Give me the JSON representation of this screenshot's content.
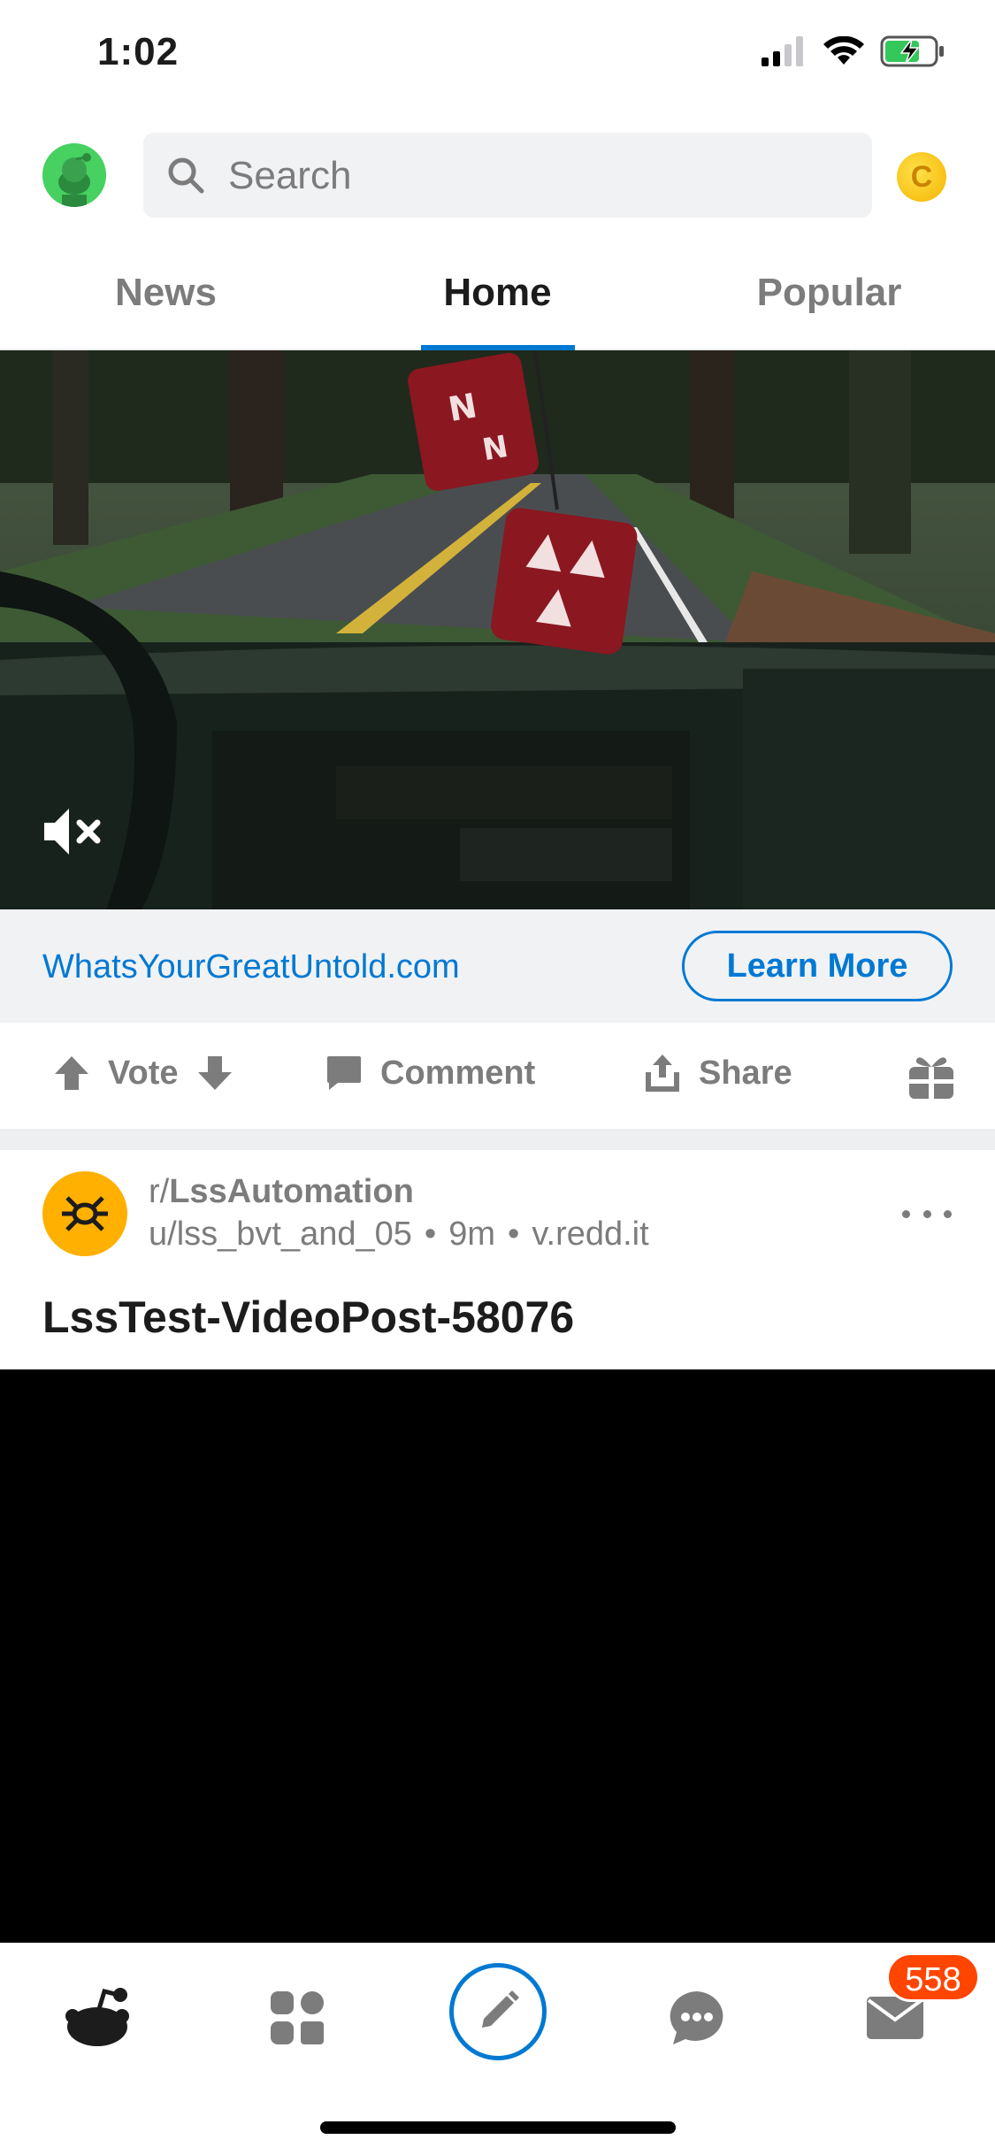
{
  "status_bar": {
    "time": "1:02"
  },
  "search": {
    "placeholder": "Search"
  },
  "coin": {
    "symbol": "C"
  },
  "tabs": [
    {
      "label": "News",
      "active": false
    },
    {
      "label": "Home",
      "active": true
    },
    {
      "label": "Popular",
      "active": false
    }
  ],
  "ad": {
    "domain": "WhatsYourGreatUntold.com",
    "cta_label": "Learn More",
    "actions": {
      "vote_label": "Vote",
      "comment_label": "Comment",
      "share_label": "Share"
    }
  },
  "post": {
    "subreddit_prefix": "r/",
    "subreddit": "LssAutomation",
    "author": "u/lss_bvt_and_05",
    "age": "9m",
    "domain": "v.redd.it",
    "title": "LssTest-VideoPost-58076"
  },
  "bottom_nav": {
    "inbox_badge": "558"
  },
  "colors": {
    "accent": "#0079d3",
    "badge": "#ff4500",
    "avatar": "#46d160",
    "subreddit_icon": "#ffb000"
  }
}
